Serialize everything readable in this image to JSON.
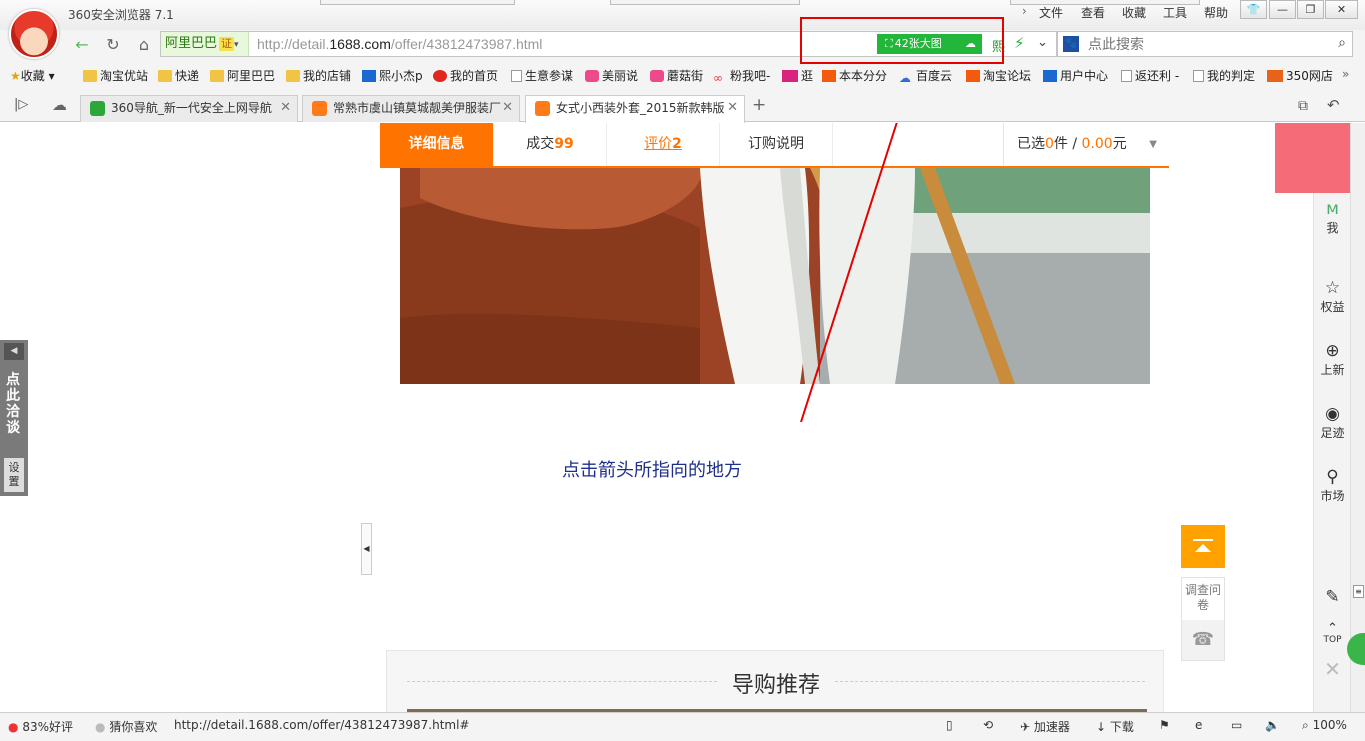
{
  "browser": {
    "title": "360安全浏览器 7.1",
    "menu": [
      "文件",
      "查看",
      "收藏",
      "工具",
      "帮助"
    ],
    "address": {
      "site_badge": "阿里巴巴",
      "cert_label": "证",
      "url_prefix": "http://detail.",
      "url_domain": "1688.com",
      "url_path": "/offer/43812473987.html",
      "image_button": "42张大图",
      "search_placeholder": "点此搜索"
    },
    "bookmarks": [
      "收藏",
      "淘宝优站",
      "快递",
      "阿里巴巴",
      "我的店铺",
      "熙小杰p",
      "我的首页",
      "生意参谋",
      "美丽说",
      "蘑菇街",
      "粉我吧-",
      "逛",
      "本本分分",
      "百度云",
      "淘宝论坛",
      "用户中心",
      "返还利 -",
      "我的判定",
      "350网店"
    ],
    "tabs": [
      {
        "label": "360导航_新一代安全上网导航"
      },
      {
        "label": "常熟市虞山镇莫城靓美伊服装厂"
      },
      {
        "label": "女式小西装外套_2015新款韩版"
      }
    ]
  },
  "page": {
    "detail_tabs": {
      "details": "详细信息",
      "deals_label": "成交",
      "deals_count": "99",
      "reviews_label": "评价",
      "reviews_count": "2",
      "order_info": "订购说明"
    },
    "selected": {
      "prefix": "已选",
      "count": "0",
      "unit": "件",
      "sep": " / ",
      "amount": "0.00",
      "currency": "元"
    },
    "instruction": "点击箭头所指向的地方",
    "consult": {
      "label": "点此洽谈",
      "settings": "设置"
    },
    "survey": "调查问卷",
    "recommend_title": "导购推荐",
    "side_panel": {
      "me": "我",
      "benefits": "权益",
      "new": "上新",
      "history": "足迹",
      "market": "市场",
      "top": "TOP"
    }
  },
  "status": {
    "rating": "83%好评",
    "guess": "猜你喜欢",
    "link": "http://detail.1688.com/offer/43812473987.html#",
    "accelerator": "加速器",
    "download": "下载",
    "zoom": "100%"
  },
  "colors": {
    "accent": "#ff7300",
    "highlight": "#e60000",
    "image_button": "#22b63b",
    "instruction": "#1f2f8a"
  }
}
